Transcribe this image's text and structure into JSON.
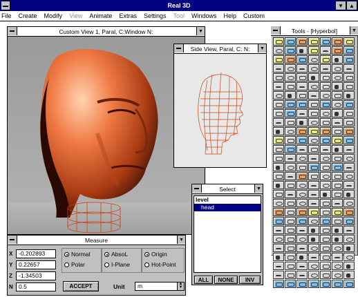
{
  "app": {
    "title": "Real 3D"
  },
  "menu": [
    "File",
    "Create",
    "Modify",
    "View",
    "Animate",
    "Extras",
    "Settings",
    "Tool",
    "Windows",
    "Help",
    "Custom"
  ],
  "menu_disabled": [
    "View",
    "Tool"
  ],
  "custom_view": {
    "title": "Custom View 1, Paral, C:Window N:"
  },
  "side_view": {
    "title": "Side View, Paral, C: N:"
  },
  "tools": {
    "title": "Tools - [Hyperbol]"
  },
  "select": {
    "title": "Select",
    "items": [
      "level",
      "head"
    ],
    "selected": "head",
    "buttons": {
      "all": "ALL",
      "none": "NONE",
      "inv": "INV"
    }
  },
  "measure": {
    "title": "Measure",
    "fields": [
      {
        "label": "X",
        "value": "-0.202893"
      },
      {
        "label": "Y",
        "value": "0.22657"
      },
      {
        "label": "Z",
        "value": "-1.34503"
      },
      {
        "label": "N",
        "value": "0.5"
      }
    ],
    "radio_col1": [
      "Normal",
      "Polar"
    ],
    "radio_col2": [
      "AbsoL",
      "I-Plane"
    ],
    "radio_col3": [
      "Origin",
      "Hot-Point"
    ],
    "accept": "ACCEPT",
    "unit_label": "Unit",
    "unit_value": "m"
  }
}
